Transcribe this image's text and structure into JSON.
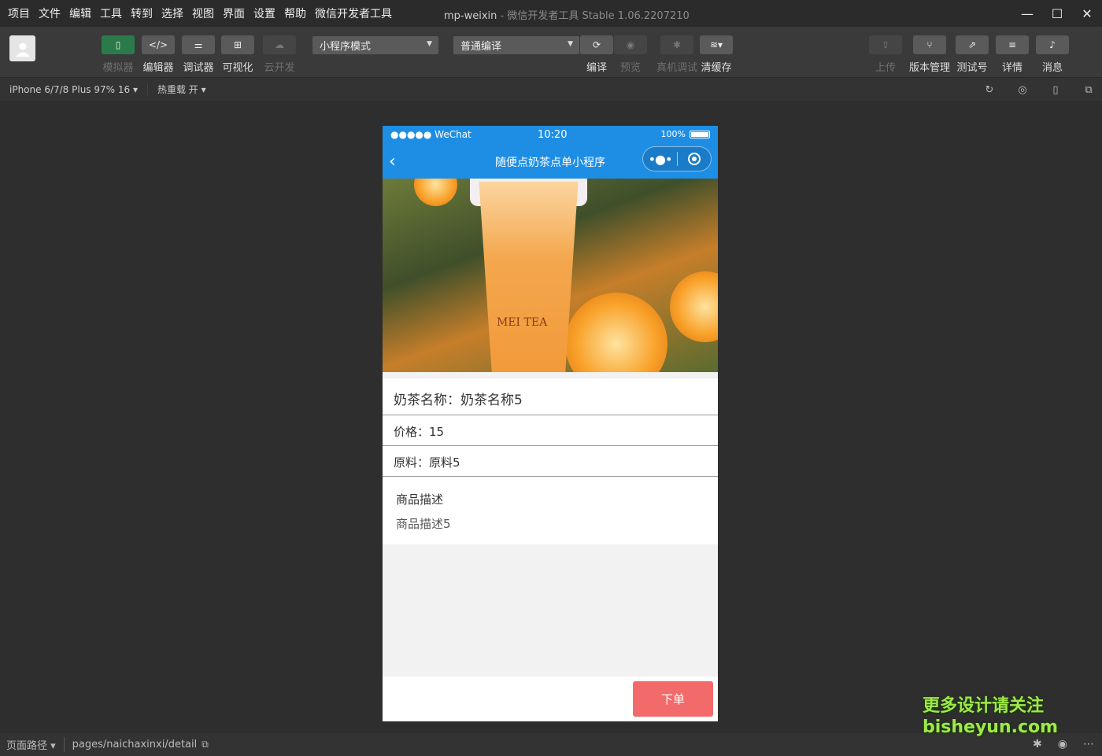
{
  "menubar": {
    "items": [
      "项目",
      "文件",
      "编辑",
      "工具",
      "转到",
      "选择",
      "视图",
      "界面",
      "设置",
      "帮助",
      "微信开发者工具"
    ],
    "title_main": "mp-weixin",
    "title_sub": " - 微信开发者工具 Stable 1.06.2207210"
  },
  "toolbar": {
    "simulator": "模拟器",
    "editor": "编辑器",
    "debugger": "调试器",
    "visual": "可视化",
    "cloud": "云开发",
    "mode_select": "小程序模式",
    "compile_select": "普通编译",
    "compile": "编译",
    "preview": "预览",
    "real_debug": "真机调试",
    "clear_cache": "清缓存",
    "upload": "上传",
    "version": "版本管理",
    "test_account": "测试号",
    "details": "详情",
    "messages": "消息"
  },
  "subbar": {
    "device": "iPhone 6/7/8 Plus 97% 16 ▾",
    "hot_reload": "热重载 开 ▾"
  },
  "phone": {
    "carrier": "●●●●● WeChat",
    "time": "10:20",
    "battery": "100%",
    "nav_title": "随便点奶茶点单小程序",
    "image_text": "MEI TEA",
    "name_line": "奶茶名称：奶茶名称5",
    "price_line": "价格：15",
    "material_line": "原料：原料5",
    "desc_title": "商品描述",
    "desc_body": "商品描述5",
    "order_button": "下单"
  },
  "footer": {
    "path_label": "页面路径 ▾",
    "path": "pages/naichaxinxi/detail"
  },
  "watermark": {
    "line1": "更多设计请关注",
    "line2": "bisheyun.com"
  },
  "colors": {
    "accent_blue": "#1e8ee4",
    "order_red": "#f26a6a",
    "active_green": "#2a7a4a"
  }
}
